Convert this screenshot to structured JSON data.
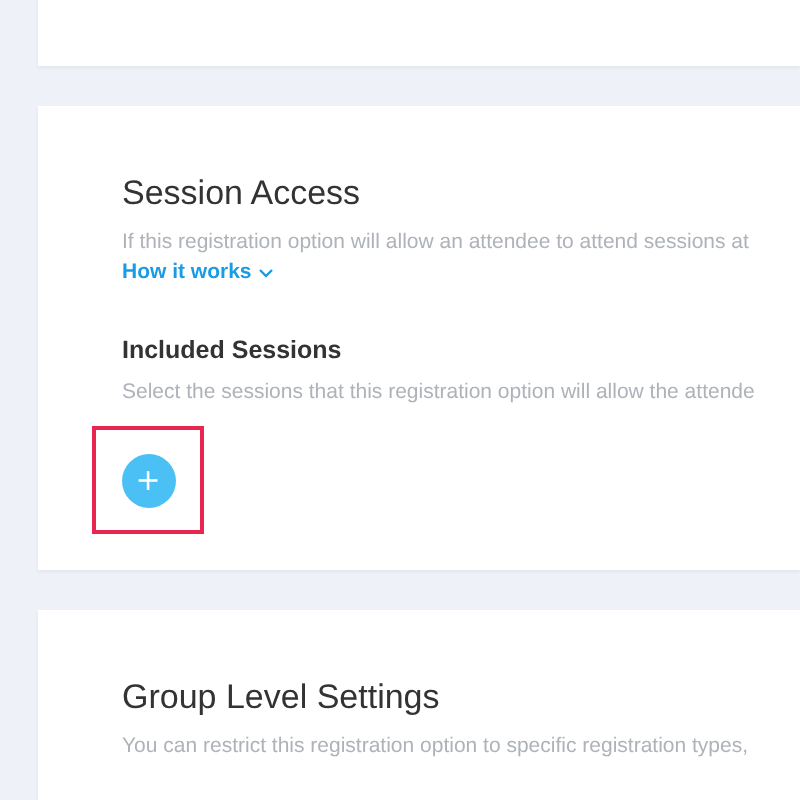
{
  "session_access": {
    "title": "Session Access",
    "description": "If this registration option will allow an attendee to attend sessions at",
    "link": "How it works",
    "included_sessions": {
      "title": "Included Sessions",
      "description": "Select the sessions that this registration option will allow the attende",
      "add_button": {
        "label": "+",
        "highlighted": true
      }
    }
  },
  "group_level_settings": {
    "title": "Group Level Settings",
    "description": "You can restrict this registration option to specific registration types,"
  }
}
